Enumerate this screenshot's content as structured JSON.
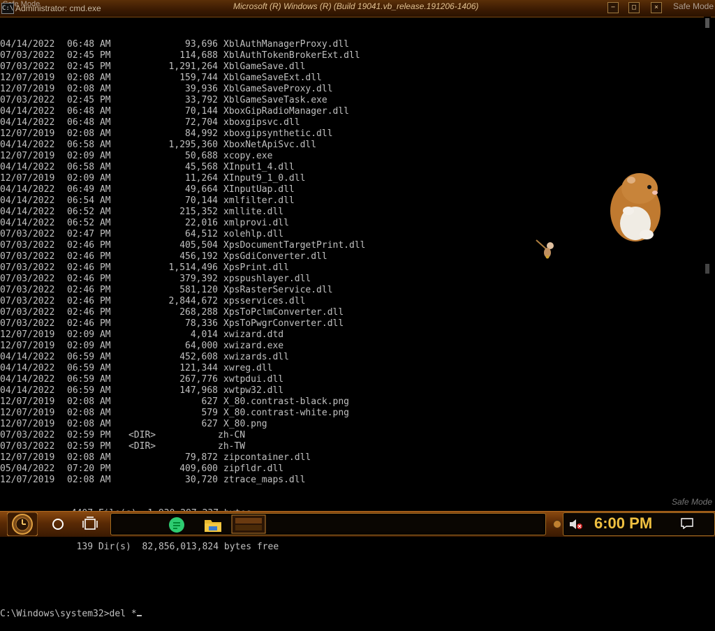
{
  "titlebar": {
    "corner_left": "Safe Mode",
    "window_title": "Administrator: cmd.exe",
    "center_title": "Microsoft (R) Windows (R) (Build 19041.vb_release.191206-1406)",
    "corner_right": "Safe Mode",
    "minimize": "−",
    "maximize": "□",
    "close": "×"
  },
  "console": {
    "entries": [
      {
        "date": "04/14/2022",
        "time": "06:48 AM",
        "size": "93,696",
        "name": "XblAuthManagerProxy.dll"
      },
      {
        "date": "07/03/2022",
        "time": "02:45 PM",
        "size": "114,688",
        "name": "XblAuthTokenBrokerExt.dll"
      },
      {
        "date": "07/03/2022",
        "time": "02:45 PM",
        "size": "1,291,264",
        "name": "XblGameSave.dll"
      },
      {
        "date": "12/07/2019",
        "time": "02:08 AM",
        "size": "159,744",
        "name": "XblGameSaveExt.dll"
      },
      {
        "date": "12/07/2019",
        "time": "02:08 AM",
        "size": "39,936",
        "name": "XblGameSaveProxy.dll"
      },
      {
        "date": "07/03/2022",
        "time": "02:45 PM",
        "size": "33,792",
        "name": "XblGameSaveTask.exe"
      },
      {
        "date": "04/14/2022",
        "time": "06:48 AM",
        "size": "70,144",
        "name": "XboxGipRadioManager.dll"
      },
      {
        "date": "04/14/2022",
        "time": "06:48 AM",
        "size": "72,704",
        "name": "xboxgipsvc.dll"
      },
      {
        "date": "12/07/2019",
        "time": "02:08 AM",
        "size": "84,992",
        "name": "xboxgipsynthetic.dll"
      },
      {
        "date": "04/14/2022",
        "time": "06:58 AM",
        "size": "1,295,360",
        "name": "XboxNetApiSvc.dll"
      },
      {
        "date": "12/07/2019",
        "time": "02:09 AM",
        "size": "50,688",
        "name": "xcopy.exe"
      },
      {
        "date": "04/14/2022",
        "time": "06:58 AM",
        "size": "45,568",
        "name": "XInput1_4.dll"
      },
      {
        "date": "12/07/2019",
        "time": "02:09 AM",
        "size": "11,264",
        "name": "XInput9_1_0.dll"
      },
      {
        "date": "04/14/2022",
        "time": "06:49 AM",
        "size": "49,664",
        "name": "XInputUap.dll"
      },
      {
        "date": "04/14/2022",
        "time": "06:54 AM",
        "size": "70,144",
        "name": "xmlfilter.dll"
      },
      {
        "date": "04/14/2022",
        "time": "06:52 AM",
        "size": "215,352",
        "name": "xmllite.dll"
      },
      {
        "date": "04/14/2022",
        "time": "06:52 AM",
        "size": "22,016",
        "name": "xmlprovi.dll"
      },
      {
        "date": "07/03/2022",
        "time": "02:47 PM",
        "size": "64,512",
        "name": "xolehlp.dll"
      },
      {
        "date": "07/03/2022",
        "time": "02:46 PM",
        "size": "405,504",
        "name": "XpsDocumentTargetPrint.dll"
      },
      {
        "date": "07/03/2022",
        "time": "02:46 PM",
        "size": "456,192",
        "name": "XpsGdiConverter.dll"
      },
      {
        "date": "07/03/2022",
        "time": "02:46 PM",
        "size": "1,514,496",
        "name": "XpsPrint.dll"
      },
      {
        "date": "07/03/2022",
        "time": "02:46 PM",
        "size": "379,392",
        "name": "xpspushlayer.dll"
      },
      {
        "date": "07/03/2022",
        "time": "02:46 PM",
        "size": "581,120",
        "name": "XpsRasterService.dll"
      },
      {
        "date": "07/03/2022",
        "time": "02:46 PM",
        "size": "2,844,672",
        "name": "xpsservices.dll"
      },
      {
        "date": "07/03/2022",
        "time": "02:46 PM",
        "size": "268,288",
        "name": "XpsToPclmConverter.dll"
      },
      {
        "date": "07/03/2022",
        "time": "02:46 PM",
        "size": "78,336",
        "name": "XpsToPwgrConverter.dll"
      },
      {
        "date": "12/07/2019",
        "time": "02:09 AM",
        "size": "4,014",
        "name": "xwizard.dtd"
      },
      {
        "date": "12/07/2019",
        "time": "02:09 AM",
        "size": "64,000",
        "name": "xwizard.exe"
      },
      {
        "date": "04/14/2022",
        "time": "06:59 AM",
        "size": "452,608",
        "name": "xwizards.dll"
      },
      {
        "date": "04/14/2022",
        "time": "06:59 AM",
        "size": "121,344",
        "name": "xwreg.dll"
      },
      {
        "date": "04/14/2022",
        "time": "06:59 AM",
        "size": "267,776",
        "name": "xwtpdui.dll"
      },
      {
        "date": "04/14/2022",
        "time": "06:59 AM",
        "size": "147,968",
        "name": "xwtpw32.dll"
      },
      {
        "date": "12/07/2019",
        "time": "02:08 AM",
        "size": "627",
        "name": "X_80.contrast-black.png"
      },
      {
        "date": "12/07/2019",
        "time": "02:08 AM",
        "size": "579",
        "name": "X_80.contrast-white.png"
      },
      {
        "date": "12/07/2019",
        "time": "02:08 AM",
        "size": "627",
        "name": "X_80.png"
      },
      {
        "date": "07/03/2022",
        "time": "02:59 PM",
        "dir": "<DIR>",
        "name": "zh-CN"
      },
      {
        "date": "07/03/2022",
        "time": "02:59 PM",
        "dir": "<DIR>",
        "name": "zh-TW"
      },
      {
        "date": "12/07/2019",
        "time": "02:08 AM",
        "size": "79,872",
        "name": "zipcontainer.dll"
      },
      {
        "date": "05/04/2022",
        "time": "07:20 PM",
        "size": "409,600",
        "name": "zipfldr.dll"
      },
      {
        "date": "12/07/2019",
        "time": "02:08 AM",
        "size": "30,720",
        "name": "ztrace_maps.dll"
      }
    ],
    "summary_files": "             4407 File(s)  1,930,297,237 bytes",
    "summary_dirs": "              139 Dir(s)  82,856,013,824 bytes free",
    "prompt": "C:\\Windows\\system32>",
    "command": "del *"
  },
  "overlay": {
    "safe_mode_bottom_right": "Safe Mode"
  },
  "taskbar": {
    "clock": "6:00 PM"
  },
  "colors": {
    "console_text": "#c0c0c0",
    "clock_text": "#f0c040",
    "taskbar_bronze": "#8a4a10"
  },
  "icons": {
    "start": "steampunk-clock-start-icon",
    "cortana": "circle-icon",
    "taskview": "task-view-icon",
    "notes": "sticky-notes-icon",
    "explorer": "folder-icon",
    "volume": "speaker-muted-icon",
    "notifications": "notification-icon"
  }
}
